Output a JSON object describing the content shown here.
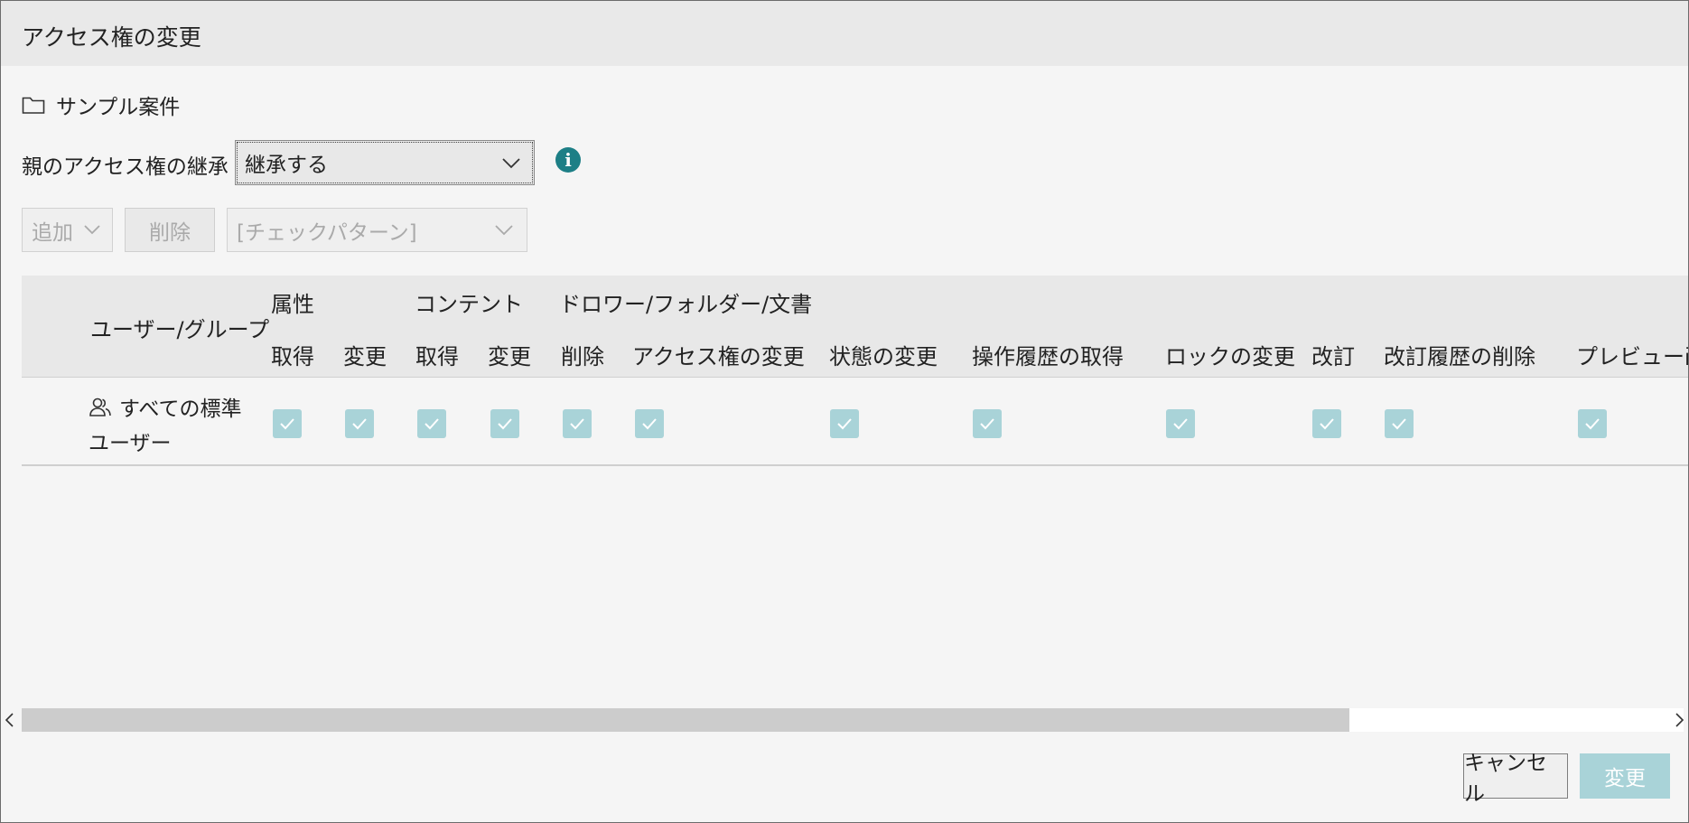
{
  "dialog": {
    "title": "アクセス権の変更",
    "folder": {
      "icon": "folder-icon",
      "name": "サンプル案件"
    },
    "inherit": {
      "label": "親のアクセス権の継承",
      "selected": "継承する",
      "info_icon": "info-icon",
      "info_glyph": "i"
    },
    "toolbar": {
      "add_label": "追加",
      "delete_label": "削除",
      "pattern_placeholder": "[チェックパターン]"
    },
    "table": {
      "user_column": "ユーザー/グループ",
      "groups": [
        "属性",
        "コンテント",
        "ドロワー/フォルダー/文書"
      ],
      "columns": [
        "取得",
        "変更",
        "取得",
        "変更",
        "削除",
        "アクセス権の変更",
        "状態の変更",
        "操作履歴の取得",
        "ロックの変更",
        "改訂",
        "改訂履歴の削除",
        "プレビュー画"
      ],
      "rows": [
        {
          "user_line1": "すべての標準",
          "user_line2": "ユーザー",
          "icon": "users-icon",
          "checked": [
            true,
            true,
            true,
            true,
            true,
            true,
            true,
            true,
            true,
            true,
            true,
            true
          ]
        }
      ]
    },
    "scrollbar": {
      "horizontal_position": 0.8
    },
    "buttons": {
      "cancel": "キャンセル",
      "apply": "変更"
    },
    "colors": {
      "accent": "#1d7f86",
      "checkbox": "#a9d3d8",
      "primary_disabled": "#a9d3d8"
    }
  }
}
